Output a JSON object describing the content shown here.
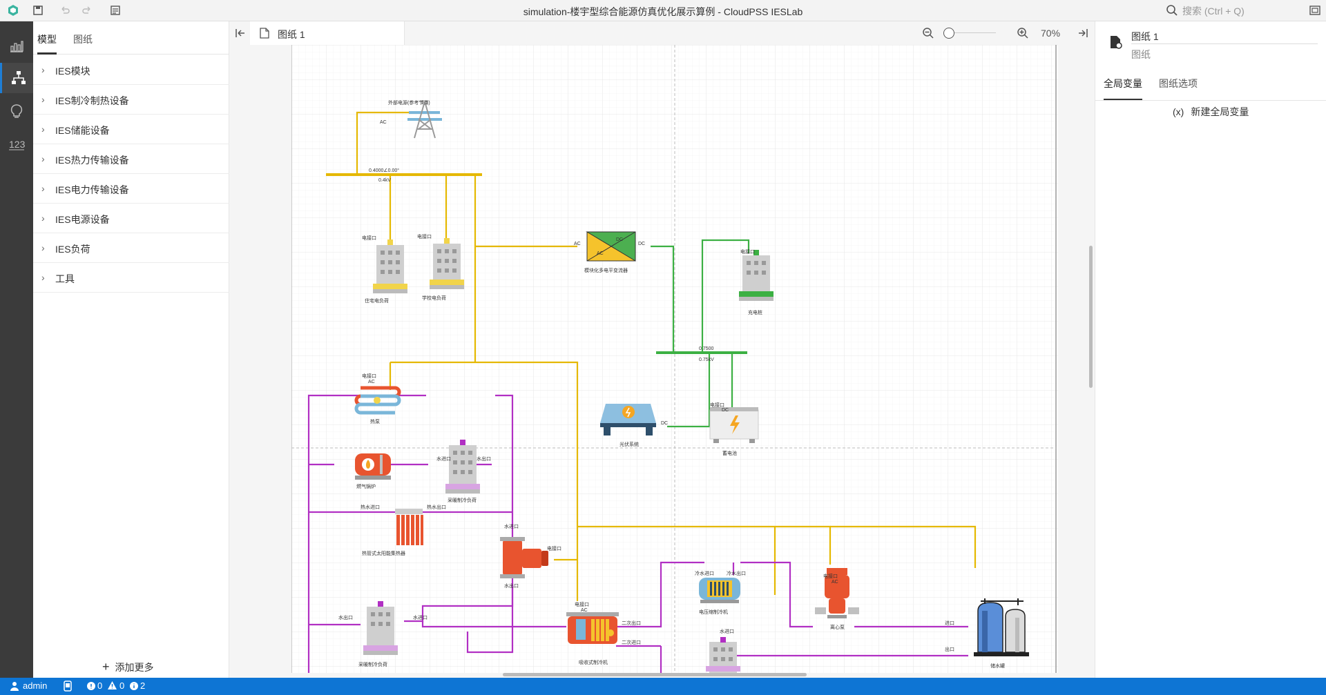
{
  "app": {
    "title": "simulation-楼宇型综合能源仿真优化展示算例 - CloudPSS IESLab",
    "search_placeholder": "搜索 (Ctrl + Q)"
  },
  "left_panel": {
    "tabs": [
      "模型",
      "图纸"
    ],
    "items": [
      "IES模块",
      "IES制冷制热设备",
      "IES储能设备",
      "IES热力传输设备",
      "IES电力传输设备",
      "IES电源设备",
      "IES负荷",
      "工具"
    ],
    "add_more": "添加更多"
  },
  "canvas": {
    "tab_label": "图纸 1",
    "zoom": "70%"
  },
  "right_panel": {
    "title": "图纸 1",
    "subtitle": "图纸",
    "tabs": [
      "全局变量",
      "图纸选项"
    ],
    "new_var_prefix": "(x)",
    "new_var": "新建全局变量"
  },
  "diagram": {
    "labels": {
      "grid": "外部电源(参考节点)",
      "ac1": "AC",
      "bus1_v": "0.4000∠0.00°",
      "bus1_kv": "0.4kV",
      "elec_port_a": "电接口",
      "elec_port_b": "电接口",
      "load_res": "住宅电负荷",
      "load_school": "学校电负荷",
      "conv_ac_l": "AC",
      "conv_dc_r": "DC",
      "conv_ac": "AC",
      "conv_dc": "DC",
      "converter": "模块化多电平变流器",
      "charger_port": "电接口",
      "charger": "充电桩",
      "bus2_v": "0.7500",
      "bus2_kv": "0.75kV",
      "pv_dc": "DC",
      "pv": "光伏系统",
      "batt_port": "电接口",
      "batt_dc": "DC",
      "battery": "蓄电池",
      "hp_port": "电接口",
      "hp_ac": "AC",
      "heat_pump": "热泵",
      "boiler": "燃气锅炉",
      "hc_load1": "采暖制冷负荷",
      "water_in1": "水进口",
      "water_out1": "水出口",
      "solar_in": "热水进口",
      "solar_out": "热水出口",
      "solar": "热管式太阳能集热器",
      "pump_in": "水进口",
      "pump_out": "水出口",
      "pump_elec": "电接口",
      "hc_load2": "采暖制冷负荷",
      "water_in2": "水进口",
      "water_out2": "水出口",
      "abs_port": "电接口",
      "abs_ac": "AC",
      "absorption": "吸收式制冷机",
      "sec_out": "二次出口",
      "sec_in": "二次进口",
      "chiller_in": "冷水进口",
      "chiller_out": "冷水出口",
      "chiller": "电压缩制冷机",
      "cpump_port": "电接口",
      "cpump_ac": "AC",
      "cpump": "离心泵",
      "tank": "储水罐",
      "water_in3": "水进口",
      "port_in": "进口",
      "port_out": "出口"
    }
  },
  "status": {
    "user": "admin",
    "errors": "0",
    "warnings": "0",
    "infos": "2"
  },
  "colors": {
    "accent": "#0e75d4",
    "electric": "#e5b800",
    "dc": "#3cb043",
    "thermal": "#b12fc3"
  }
}
